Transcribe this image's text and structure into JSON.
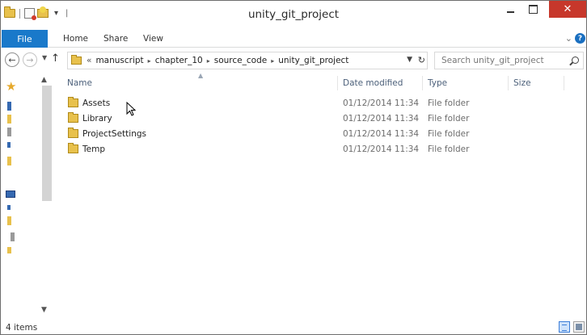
{
  "window": {
    "title": "unity_git_project",
    "close_glyph": "✕"
  },
  "ribbon": {
    "tabs": [
      "File",
      "Home",
      "Share",
      "View"
    ],
    "help_glyph": "?"
  },
  "address": {
    "overflow": "«",
    "breadcrumbs": [
      "manuscript",
      "chapter_10",
      "source_code",
      "unity_git_project"
    ],
    "search_placeholder": "Search unity_git_project"
  },
  "columns": {
    "name": "Name",
    "date": "Date modified",
    "type": "Type",
    "size": "Size"
  },
  "files": [
    {
      "name": "Assets",
      "date": "01/12/2014 11:34",
      "type": "File folder"
    },
    {
      "name": "Library",
      "date": "01/12/2014 11:34",
      "type": "File folder"
    },
    {
      "name": "ProjectSettings",
      "date": "01/12/2014 11:34",
      "type": "File folder"
    },
    {
      "name": "Temp",
      "date": "01/12/2014 11:34",
      "type": "File folder"
    }
  ],
  "status": {
    "item_count": "4 items"
  },
  "icons": {
    "folder": "folder-icon",
    "accent": "#1979ca",
    "close_button": "#c7372b"
  }
}
